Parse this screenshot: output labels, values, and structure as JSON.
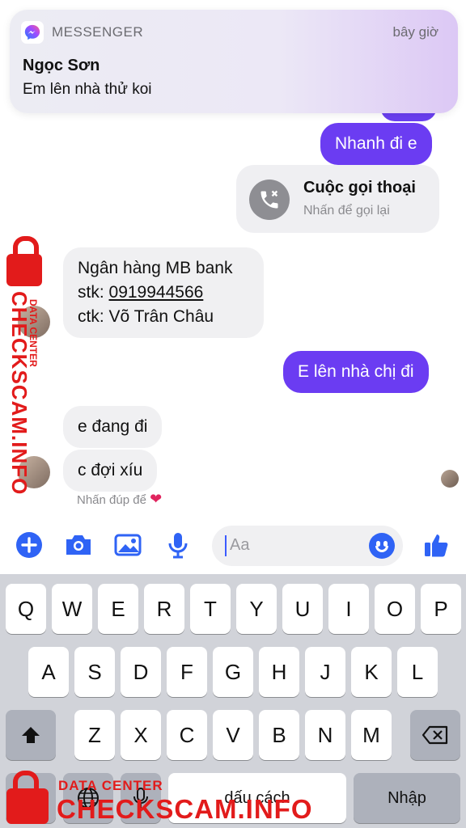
{
  "notification": {
    "app": "MESSENGER",
    "time": "bây giờ",
    "sender": "Ngọc Sơn",
    "text": "Em lên nhà thử koi"
  },
  "messages": {
    "m1": "Nhanh đi e",
    "call_title": "Cuộc gọi thoại",
    "call_sub": "Nhấn để gọi lại",
    "bank_line1": "Ngân hàng MB bank",
    "bank_line2_prefix": "stk: ",
    "bank_account": "0919944566",
    "bank_line3": "ctk: Võ Trân Châu",
    "m2": "E lên nhà chị đi",
    "m3": "e đang đi",
    "m4": "c đợi xíu",
    "hint": "Nhấn đúp để"
  },
  "composer": {
    "placeholder": "Aa"
  },
  "keyboard": {
    "row1": [
      "Q",
      "W",
      "E",
      "R",
      "T",
      "Y",
      "U",
      "I",
      "O",
      "P"
    ],
    "row2": [
      "A",
      "S",
      "D",
      "F",
      "G",
      "H",
      "J",
      "K",
      "L"
    ],
    "row3": [
      "Z",
      "X",
      "C",
      "V",
      "B",
      "N",
      "M"
    ],
    "space": "dấu cách",
    "enter": "Nhập"
  },
  "watermark": {
    "brand": "CHECKSCAM.INFO",
    "tag": "DATA CENTER",
    "color": "#e21b1b"
  },
  "colors": {
    "outgoing": "#6b3cf2",
    "incoming": "#f0f0f2",
    "accent": "#2f63f5"
  }
}
